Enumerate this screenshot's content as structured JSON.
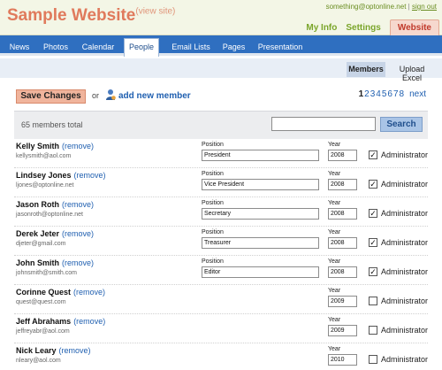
{
  "header": {
    "site_title": "Sample Website",
    "view_site": "(view site)",
    "user_email": "something@optonline.net",
    "separator": "|",
    "sign_out": "sign out",
    "nav": [
      "My Info",
      "Settings"
    ],
    "active_nav": "Website"
  },
  "tabs": [
    {
      "label": "News"
    },
    {
      "label": "Photos"
    },
    {
      "label": "Calendar"
    },
    {
      "label": "People"
    },
    {
      "label": "Email Lists"
    },
    {
      "label": "Pages"
    },
    {
      "label": "Presentation"
    }
  ],
  "active_tab": "People",
  "subtabs": [
    {
      "label": "Members",
      "active": true
    },
    {
      "label": "Upload Excel",
      "active": false
    }
  ],
  "actions": {
    "save_label": "Save Changes",
    "or_text": "or",
    "add_member": "add new member",
    "add_icon": "person-icon"
  },
  "pager": {
    "pages": [
      "1",
      "2",
      "3",
      "4",
      "5",
      "6",
      "7",
      "8"
    ],
    "current": "1",
    "next": "next"
  },
  "summary": {
    "total": "65 members total",
    "search_value": "",
    "search_label": "Search"
  },
  "field_labels": {
    "position": "Position",
    "year": "Year",
    "admin": "Administrator",
    "remove": "(remove)"
  },
  "members": [
    {
      "name": "Kelly Smith",
      "email": "kellysmith@aol.com",
      "position": "President",
      "year": "2008",
      "admin": true
    },
    {
      "name": "Lindsey Jones",
      "email": "ljones@optonline.net",
      "position": "Vice President",
      "year": "2008",
      "admin": true
    },
    {
      "name": "Jason Roth",
      "email": "jasonroth@optonline.net",
      "position": "Secretary",
      "year": "2008",
      "admin": true
    },
    {
      "name": "Derek Jeter",
      "email": "djeter@gmail.com",
      "position": "Treasurer",
      "year": "2008",
      "admin": true
    },
    {
      "name": "John Smith",
      "email": "johnsmith@smith.com",
      "position": "Editor",
      "year": "2008",
      "admin": true
    },
    {
      "name": "Corinne Quest",
      "email": "quest@quest.com",
      "position": "",
      "year": "2009",
      "admin": false
    },
    {
      "name": "Jeff Abrahams",
      "email": "jeffreyabr@aol.com",
      "position": "",
      "year": "2009",
      "admin": false
    },
    {
      "name": "Nick Leary",
      "email": "nleary@aol.com",
      "position": "",
      "year": "2010",
      "admin": false
    }
  ],
  "colors": {
    "accent_blue": "#2f6fc0",
    "title_orange": "#e07a5c",
    "link_blue": "#1f5fb0",
    "save_button": "#f0b49c"
  }
}
